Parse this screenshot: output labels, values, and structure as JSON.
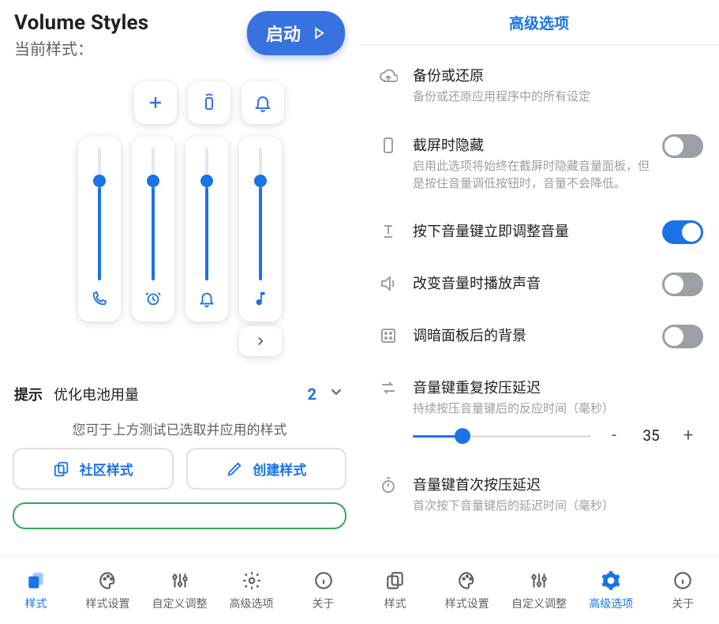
{
  "left": {
    "app_title": "Volume Styles",
    "current_style_label": "当前样式：",
    "launch": "启动",
    "sliders": [
      {
        "value": 70,
        "icon": "phone-icon"
      },
      {
        "value": 70,
        "icon": "alarm-icon"
      },
      {
        "value": 70,
        "icon": "bell-icon"
      },
      {
        "value": 70,
        "icon": "music-note-icon"
      }
    ],
    "hint_tag": "提示",
    "hint_text": "优化电池用量",
    "hint_count": "2",
    "test_note": "您可于上方测试已选取并应用的样式",
    "btn_community": "社区样式",
    "btn_create": "创建样式"
  },
  "right": {
    "title": "高级选项",
    "items": {
      "backup": {
        "title": "备份或还原",
        "sub": "备份或还原应用程序中的所有设定"
      },
      "hide_on_screenshot": {
        "title": "截屏时隐藏",
        "sub": "启用此选项将始终在截屏时隐藏音量面板，但是按住音量调低按钮时，音量不会降低。",
        "on": false
      },
      "instant_adjust": {
        "title": "按下音量键立即调整音量",
        "on": true
      },
      "play_sound": {
        "title": "改变音量时播放声音",
        "on": false
      },
      "dim_bg": {
        "title": "调暗面板后的背景",
        "on": false
      },
      "repeat_delay": {
        "title": "音量键重复按压延迟",
        "sub": "持续按压音量键后的反应时间（毫秒）",
        "value": "35",
        "pct": 28
      },
      "first_delay": {
        "title": "音量键首次按压延迟",
        "sub": "首次按下音量键后的延迟时间（毫秒）"
      }
    }
  },
  "nav": {
    "tabs": [
      "样式",
      "样式设置",
      "自定义调整",
      "高级选项",
      "关于"
    ]
  }
}
